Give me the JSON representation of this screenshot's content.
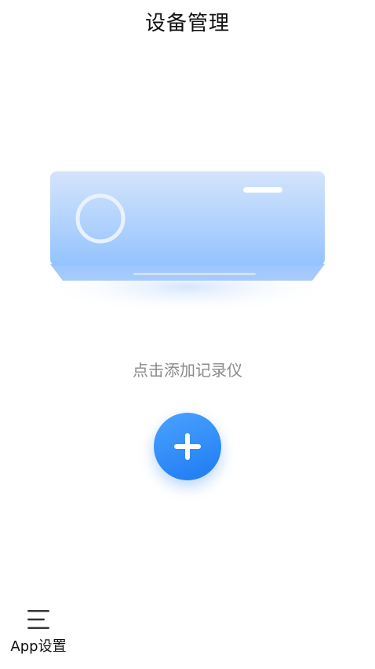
{
  "header": {
    "title": "设备管理"
  },
  "main": {
    "illustration_icon": "air-conditioner-illustration",
    "empty_hint": "点击添加记录仪",
    "add_button_icon": "plus-icon"
  },
  "bottom_nav": {
    "settings_label": "App设置",
    "settings_icon": "menu-icon"
  },
  "colors": {
    "accent": "#2b8cfa",
    "hint_text": "#8a8a8a",
    "title_text": "#111111",
    "illustration_light": "#d4e4fb",
    "illustration_mid": "#9cc6ff"
  }
}
